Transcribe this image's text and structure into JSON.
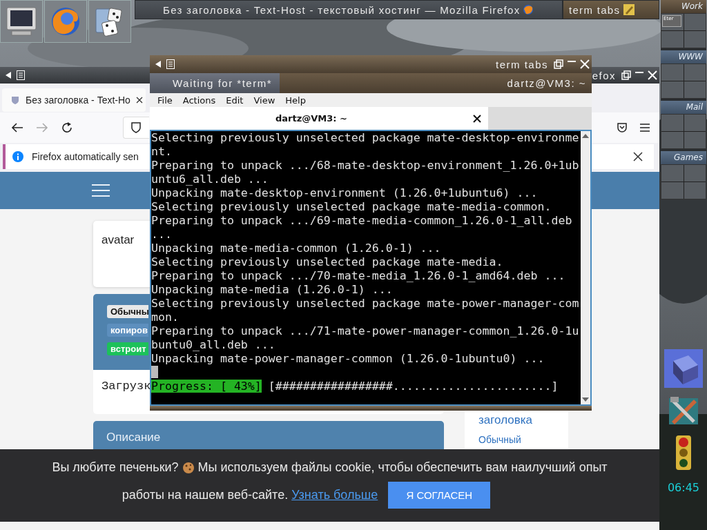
{
  "taskbar": {
    "tasks": [
      {
        "title": "Без заголовка - Text-Host - текстовый хостинг — Mozilla Firefox",
        "selected": false
      },
      {
        "title": "term tabs",
        "selected": true
      }
    ]
  },
  "pager": {
    "desks": [
      {
        "name": "Work",
        "selected": true,
        "windows": [
          {
            "label": "Eter"
          }
        ]
      },
      {
        "name": "WWW",
        "selected": false
      },
      {
        "name": "Mail",
        "selected": false
      },
      {
        "name": "Games",
        "selected": false
      }
    ]
  },
  "clock": "06:45",
  "firefox": {
    "title": "efox",
    "tab": {
      "title": "Без заголовка - Text-Ho"
    },
    "notification": "Firefox automatically sen",
    "page": {
      "avatar": "avatar",
      "badges": [
        {
          "label": "Обычны",
          "kind": "plain"
        },
        {
          "label": "копиров",
          "kind": "copy"
        },
        {
          "label": "встроит",
          "kind": "embed"
        }
      ],
      "loading": "Загрузк",
      "description": "Описание",
      "sidebar": {
        "title": "заголовка",
        "link": "Обычный"
      }
    },
    "cookie": {
      "text_before": "Вы любите печеньки?",
      "text_after": "Мы используем файлы cookie, чтобы обеспечить вам наилучший опыт",
      "line_2": "работы на нашем веб-сайте.",
      "link": "Узнать больше",
      "button": "Я СОГЛАСЕН"
    }
  },
  "terminal": {
    "title": "term tabs",
    "tabs": [
      {
        "label": "Waiting for *term*",
        "selected": true
      },
      {
        "label": "dartz@VM3: ~",
        "selected": false
      }
    ],
    "menu": [
      "File",
      "Actions",
      "Edit",
      "View",
      "Help"
    ],
    "session_tab": "dartz@VM3: ~",
    "lines": [
      {
        "kind": "text",
        "text": "Selecting previously unselected package mate-desktop-environme"
      },
      {
        "kind": "text",
        "text": "nt."
      },
      {
        "kind": "text",
        "text": "Preparing to unpack .../68-mate-desktop-environment_1.26.0+1ub"
      },
      {
        "kind": "text",
        "text": "untu6_all.deb ..."
      },
      {
        "kind": "text",
        "text": "Unpacking mate-desktop-environment (1.26.0+1ubuntu6) ..."
      },
      {
        "kind": "text",
        "text": "Selecting previously unselected package mate-media-common."
      },
      {
        "kind": "text",
        "text": "Preparing to unpack .../69-mate-media-common_1.26.0-1_all.deb"
      },
      {
        "kind": "text",
        "text": "..."
      },
      {
        "kind": "text",
        "text": "Unpacking mate-media-common (1.26.0-1) ..."
      },
      {
        "kind": "text",
        "text": "Selecting previously unselected package mate-media."
      },
      {
        "kind": "text",
        "text": "Preparing to unpack .../70-mate-media_1.26.0-1_amd64.deb ..."
      },
      {
        "kind": "text",
        "text": "Unpacking mate-media (1.26.0-1) ..."
      },
      {
        "kind": "text",
        "text": "Selecting previously unselected package mate-power-manager-com"
      },
      {
        "kind": "text",
        "text": "mon."
      },
      {
        "kind": "text",
        "text": "Preparing to unpack .../71-mate-power-manager-common_1.26.0-1u"
      },
      {
        "kind": "text",
        "text": "buntu0_all.deb ..."
      },
      {
        "kind": "text",
        "text": "Unpacking mate-power-manager-common (1.26.0-1ubuntu0) ..."
      },
      {
        "kind": "cursor"
      },
      {
        "kind": "progress",
        "label": "Progress: [ 43%]",
        "text": "[#################.......................]"
      }
    ]
  }
}
